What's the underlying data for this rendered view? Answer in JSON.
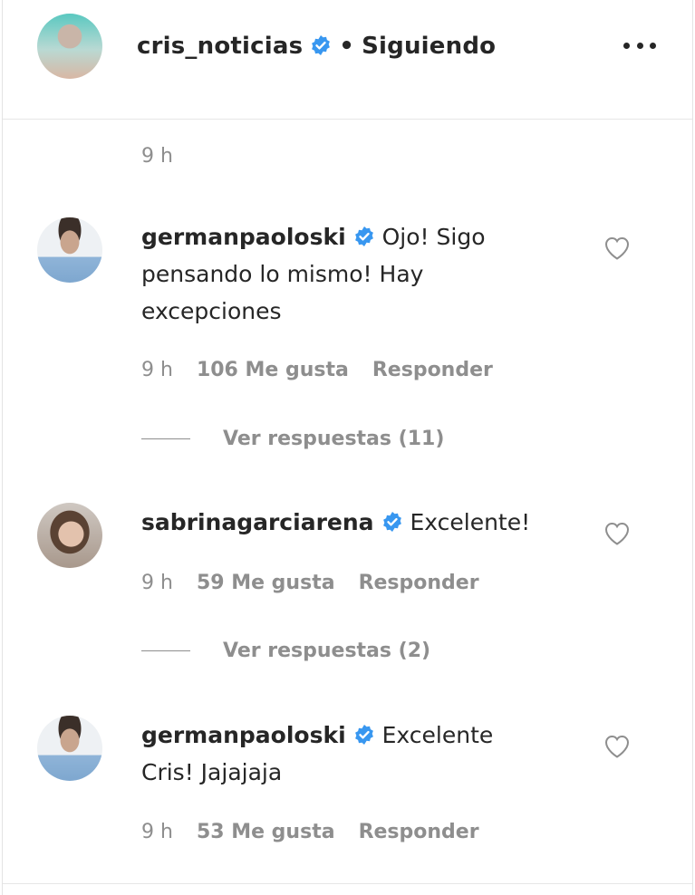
{
  "post": {
    "owner": "cris_noticias",
    "separator": "•",
    "follow_status": "Siguiendo",
    "time": "9 h"
  },
  "comments": [
    {
      "user": "germanpaoloski",
      "text": "Ojo! Sigo pensando lo mismo! Hay excepciones",
      "time": "9 h",
      "likes": "106 Me gusta",
      "reply": "Responder",
      "view_replies": "Ver respuestas (11)"
    },
    {
      "user": "sabrinagarciarena",
      "text": "Excelente!",
      "time": "9 h",
      "likes": "59 Me gusta",
      "reply": "Responder",
      "view_replies": "Ver respuestas (2)"
    },
    {
      "user": "germanpaoloski",
      "text": "Excelente Cris! Jajajaja",
      "time": "9 h",
      "likes": "53 Me gusta",
      "reply": "Responder"
    }
  ],
  "colors": {
    "verified_blue": "#3897f0",
    "secondary_text": "#8e8e8e",
    "primary_text": "#262626"
  },
  "icons": {
    "verified": "verified-badge-icon",
    "more": "more-options-icon",
    "like": "heart-icon"
  }
}
